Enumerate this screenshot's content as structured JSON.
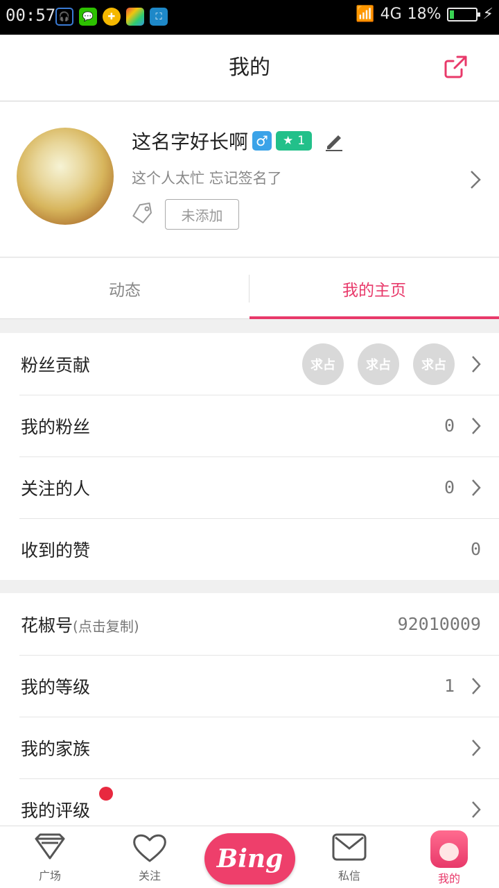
{
  "status_bar": {
    "time": "00:57",
    "network": "4G",
    "battery": "18%",
    "battery_level": 0.18
  },
  "header": {
    "title": "我的"
  },
  "profile": {
    "nickname": "这名字好长啊",
    "gender_symbol": "♂",
    "level": "1",
    "signature": "这个人太忙 忘记签名了",
    "tag_placeholder": "未添加"
  },
  "tabs": [
    {
      "label": "动态"
    },
    {
      "label": "我的主页"
    }
  ],
  "group1": {
    "rows": [
      {
        "label": "粉丝贡献",
        "value": "",
        "fan_avatars": [
          "求占",
          "求占",
          "求占"
        ]
      },
      {
        "label": "我的粉丝",
        "value": "0"
      },
      {
        "label": "关注的人",
        "value": "0"
      },
      {
        "label": "收到的赞",
        "value": "0"
      }
    ]
  },
  "group2": {
    "rows": [
      {
        "label": "花椒号",
        "sub": "(点击复制)",
        "value": "92010009"
      },
      {
        "label": "我的等级",
        "value": "1"
      },
      {
        "label": "我的家族",
        "value": ""
      },
      {
        "label": "我的评级",
        "value": ""
      }
    ]
  },
  "bottom_nav": {
    "items": [
      {
        "label": "广场",
        "icon": "diamond-icon"
      },
      {
        "label": "关注",
        "icon": "heart-icon"
      },
      {
        "label": "Bing",
        "icon": "bing-button"
      },
      {
        "label": "私信",
        "icon": "mail-icon"
      },
      {
        "label": "我的",
        "icon": "me-avatar-icon"
      }
    ]
  },
  "colors": {
    "accent": "#e8396a",
    "badge_blue": "#3ba3e8",
    "badge_green": "#22c08a",
    "notification_dot": "#e8293f"
  }
}
